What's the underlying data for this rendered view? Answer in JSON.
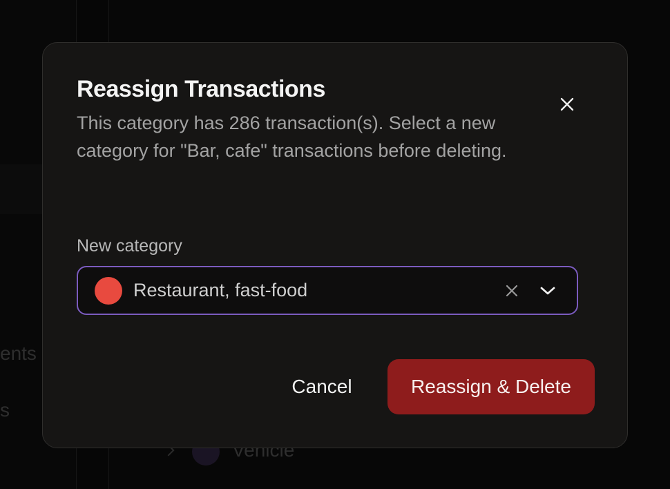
{
  "background": {
    "partial_text_1": "ents",
    "partial_text_2": "s",
    "partial_item": "Vehicle"
  },
  "dialog": {
    "title": "Reassign Transactions",
    "description": "This category has 286 transaction(s). Select a new category for \"Bar, cafe\" transactions before deleting.",
    "field_label": "New category",
    "selected_category": {
      "name": "Restaurant, fast-food",
      "color": "#e84a3f"
    },
    "cancel_label": "Cancel",
    "confirm_label": "Reassign & Delete"
  },
  "colors": {
    "accent_border": "#7b5bbf",
    "destructive": "#8e1c1c"
  },
  "icons": {
    "close": "close-icon",
    "clear": "clear-icon",
    "dropdown": "chevron-down-icon"
  }
}
